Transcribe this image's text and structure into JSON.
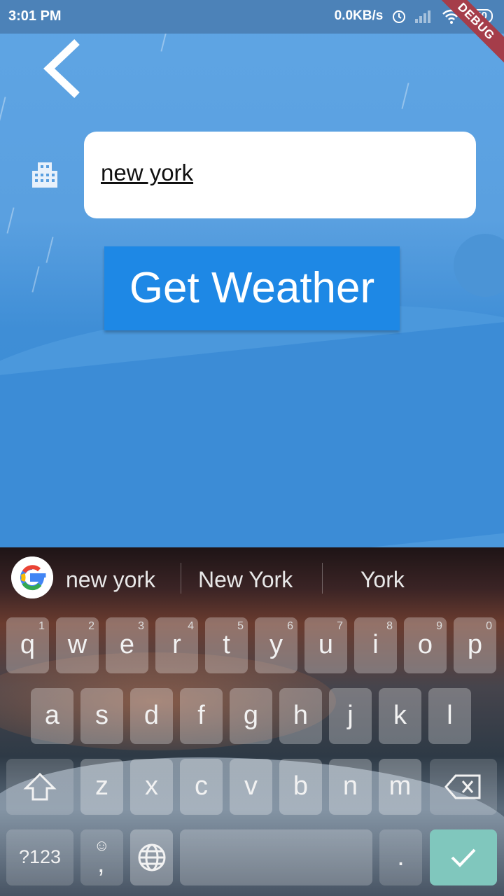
{
  "status_bar": {
    "time": "3:01 PM",
    "net_speed": "0.0KB/s",
    "battery": "40",
    "debug_banner": "DEBUG"
  },
  "search": {
    "value": "new york",
    "button_label": "Get Weather"
  },
  "keyboard": {
    "suggestions": [
      "new york",
      "New York",
      "York"
    ],
    "row1": [
      {
        "k": "q",
        "n": "1"
      },
      {
        "k": "w",
        "n": "2"
      },
      {
        "k": "e",
        "n": "3"
      },
      {
        "k": "r",
        "n": "4"
      },
      {
        "k": "t",
        "n": "5"
      },
      {
        "k": "y",
        "n": "6"
      },
      {
        "k": "u",
        "n": "7"
      },
      {
        "k": "i",
        "n": "8"
      },
      {
        "k": "o",
        "n": "9"
      },
      {
        "k": "p",
        "n": "0"
      }
    ],
    "row2": [
      "a",
      "s",
      "d",
      "f",
      "g",
      "h",
      "j",
      "k",
      "l"
    ],
    "row3": [
      "z",
      "x",
      "c",
      "v",
      "b",
      "n",
      "m"
    ],
    "symbols_label": "?123",
    "comma_label": ",",
    "period_label": ".",
    "accent_color": "#80c7bd"
  }
}
